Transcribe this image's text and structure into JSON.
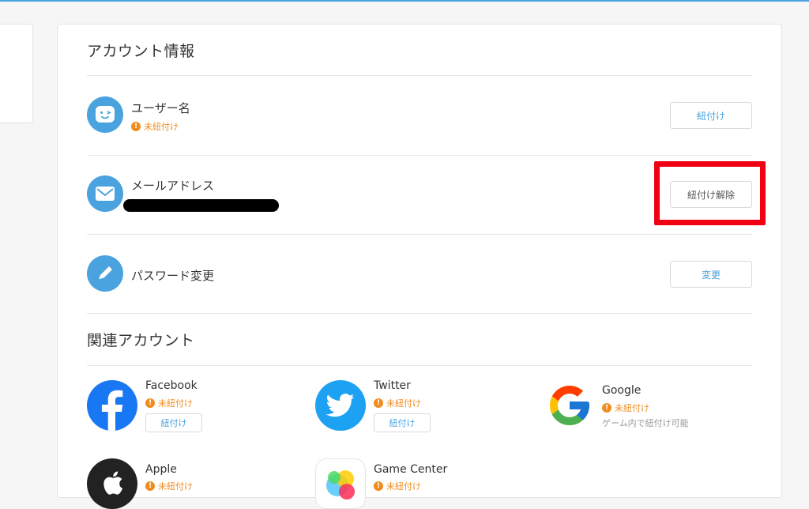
{
  "account_info": {
    "title": "アカウント情報",
    "rows": [
      {
        "label": "ユーザー名",
        "status": "未紐付け",
        "button": "紐付け"
      },
      {
        "label": "メールアドレス",
        "button": "紐付け解除"
      },
      {
        "label": "パスワード変更",
        "button": "変更"
      }
    ]
  },
  "related_accounts": {
    "title": "関連アカウント",
    "items": [
      {
        "name": "Facebook",
        "status": "未紐付け",
        "button": "紐付け",
        "icon": "facebook-icon"
      },
      {
        "name": "Twitter",
        "status": "未紐付け",
        "button": "紐付け",
        "icon": "twitter-icon"
      },
      {
        "name": "Google",
        "status": "未紐付け",
        "note": "ゲーム内で紐付け可能",
        "icon": "google-icon"
      },
      {
        "name": "Apple",
        "status": "未紐付け",
        "icon": "apple-icon"
      },
      {
        "name": "Game Center",
        "status": "未紐付け",
        "icon": "game-center-icon"
      }
    ]
  },
  "colors": {
    "accent": "#4aa3df",
    "warning": "#f08c1d",
    "highlight": "#f00012",
    "facebook": "#1877f2",
    "twitter": "#1da1f2"
  }
}
